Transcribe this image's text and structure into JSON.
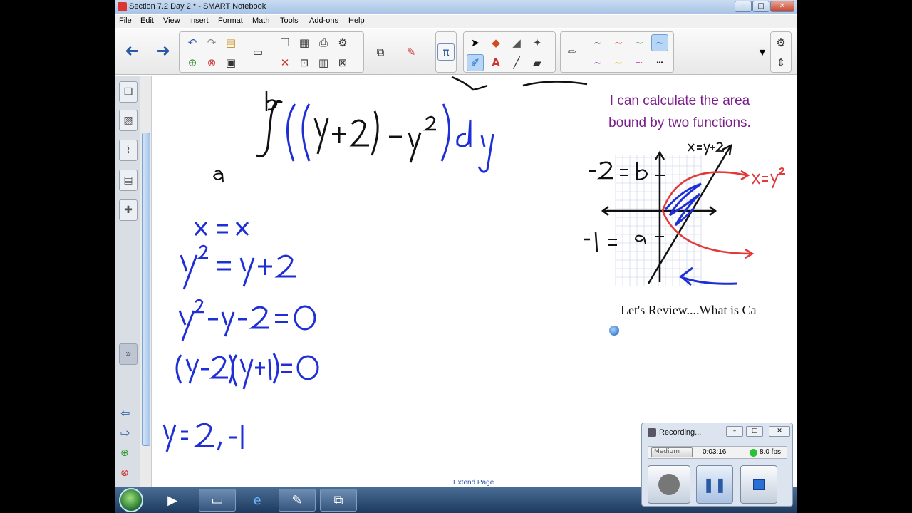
{
  "window": {
    "title": "Section 7.2 Day 2 * - SMART Notebook"
  },
  "menu": [
    "File",
    "Edit",
    "View",
    "Insert",
    "Format",
    "Math",
    "Tools",
    "Add-ons",
    "Help"
  ],
  "toolbar": {
    "math_symbol": "π"
  },
  "canvas": {
    "goal_line1": "I can calculate the area",
    "goal_line2": "bound by two functions.",
    "review_text": "Let's Review....What is Ca",
    "extend_label": "Extend Page"
  },
  "recording": {
    "title": "Recording...",
    "quality_label": "Medium",
    "elapsed": "0:03:16",
    "fps": "8.0 fps",
    "status_color": "#2bc23a"
  },
  "colors": {
    "ink_blue": "#1f2fd6",
    "ink_black": "#111111",
    "ink_red": "#e23a3a",
    "goal_purple": "#7a1d8a"
  }
}
